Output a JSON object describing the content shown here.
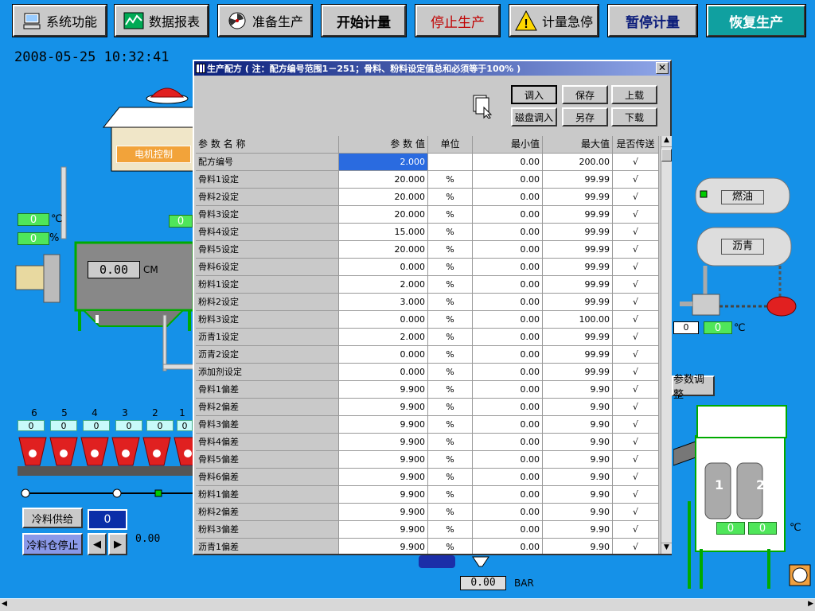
{
  "toolbar": {
    "system": "系统功能",
    "reports": "数据报表",
    "prepare": "准备生产",
    "start_metering": "开始计量",
    "stop_production": "停止生产",
    "emergency_stop": "计量急停",
    "pause_metering": "暂停计量",
    "resume_production": "恢复生产"
  },
  "datetime": "2008-05-25 10:32:41",
  "scada": {
    "motor_control": "电机控制",
    "temp1": "0",
    "temp1_unit": "℃",
    "pct1": "0",
    "pct1_unit": "%",
    "drum_value": "0.00",
    "drum_unit": "CM",
    "left_small": "0",
    "fuel_tank": "燃油",
    "asphalt_tank": "沥青",
    "asph_val1": "0",
    "asph_val2": "0",
    "asph_unit": "℃",
    "param_adjust": "参数调整",
    "hopper_numbers": [
      "6",
      "5",
      "4",
      "3",
      "2",
      "1"
    ],
    "hopper_values": [
      "0",
      "0",
      "0",
      "0",
      "0",
      "0"
    ],
    "cold_feed": "冷料供给",
    "cold_feed_value": "0",
    "cold_bin_stop": "冷料仓停止",
    "feed_rate": "0.00",
    "silo_label1": "1",
    "silo_label2": "2",
    "silo_val1": "0",
    "silo_val2": "0",
    "silo_unit": "℃",
    "pressure": "0.00",
    "pressure_unit": "BAR"
  },
  "dialog": {
    "title": "生产配方 ( 注：配方编号范围1－251；骨料、粉料设定值总和必须等于100% )",
    "buttons": {
      "load": "调入",
      "save": "保存",
      "upload": "上载",
      "disk_load": "磁盘调入",
      "save_as": "另存",
      "download": "下载"
    },
    "columns": [
      "参 数 名 称",
      "参 数 值",
      "单位",
      "最小值",
      "最大值",
      "是否传送"
    ],
    "rows": [
      {
        "name": "配方编号",
        "value": "2.000",
        "unit": "",
        "min": "0.00",
        "max": "200.00",
        "send": "√"
      },
      {
        "name": "骨料1设定",
        "value": "20.000",
        "unit": "%",
        "min": "0.00",
        "max": "99.99",
        "send": "√"
      },
      {
        "name": "骨料2设定",
        "value": "20.000",
        "unit": "%",
        "min": "0.00",
        "max": "99.99",
        "send": "√"
      },
      {
        "name": "骨料3设定",
        "value": "20.000",
        "unit": "%",
        "min": "0.00",
        "max": "99.99",
        "send": "√"
      },
      {
        "name": "骨料4设定",
        "value": "15.000",
        "unit": "%",
        "min": "0.00",
        "max": "99.99",
        "send": "√"
      },
      {
        "name": "骨料5设定",
        "value": "20.000",
        "unit": "%",
        "min": "0.00",
        "max": "99.99",
        "send": "√"
      },
      {
        "name": "骨料6设定",
        "value": "0.000",
        "unit": "%",
        "min": "0.00",
        "max": "99.99",
        "send": "√"
      },
      {
        "name": "粉料1设定",
        "value": "2.000",
        "unit": "%",
        "min": "0.00",
        "max": "99.99",
        "send": "√"
      },
      {
        "name": "粉料2设定",
        "value": "3.000",
        "unit": "%",
        "min": "0.00",
        "max": "99.99",
        "send": "√"
      },
      {
        "name": "粉料3设定",
        "value": "0.000",
        "unit": "%",
        "min": "0.00",
        "max": "100.00",
        "send": "√"
      },
      {
        "name": "沥青1设定",
        "value": "2.000",
        "unit": "%",
        "min": "0.00",
        "max": "99.99",
        "send": "√"
      },
      {
        "name": "沥青2设定",
        "value": "0.000",
        "unit": "%",
        "min": "0.00",
        "max": "99.99",
        "send": "√"
      },
      {
        "name": "添加剂设定",
        "value": "0.000",
        "unit": "%",
        "min": "0.00",
        "max": "99.99",
        "send": "√"
      },
      {
        "name": "骨料1偏差",
        "value": "9.900",
        "unit": "%",
        "min": "0.00",
        "max": "9.90",
        "send": "√"
      },
      {
        "name": "骨料2偏差",
        "value": "9.900",
        "unit": "%",
        "min": "0.00",
        "max": "9.90",
        "send": "√"
      },
      {
        "name": "骨料3偏差",
        "value": "9.900",
        "unit": "%",
        "min": "0.00",
        "max": "9.90",
        "send": "√"
      },
      {
        "name": "骨料4偏差",
        "value": "9.900",
        "unit": "%",
        "min": "0.00",
        "max": "9.90",
        "send": "√"
      },
      {
        "name": "骨料5偏差",
        "value": "9.900",
        "unit": "%",
        "min": "0.00",
        "max": "9.90",
        "send": "√"
      },
      {
        "name": "骨料6偏差",
        "value": "9.900",
        "unit": "%",
        "min": "0.00",
        "max": "9.90",
        "send": "√"
      },
      {
        "name": "粉料1偏差",
        "value": "9.900",
        "unit": "%",
        "min": "0.00",
        "max": "9.90",
        "send": "√"
      },
      {
        "name": "粉料2偏差",
        "value": "9.900",
        "unit": "%",
        "min": "0.00",
        "max": "9.90",
        "send": "√"
      },
      {
        "name": "粉料3偏差",
        "value": "9.900",
        "unit": "%",
        "min": "0.00",
        "max": "9.90",
        "send": "√"
      },
      {
        "name": "沥青1偏差",
        "value": "9.900",
        "unit": "%",
        "min": "0.00",
        "max": "9.90",
        "send": "√"
      }
    ]
  }
}
